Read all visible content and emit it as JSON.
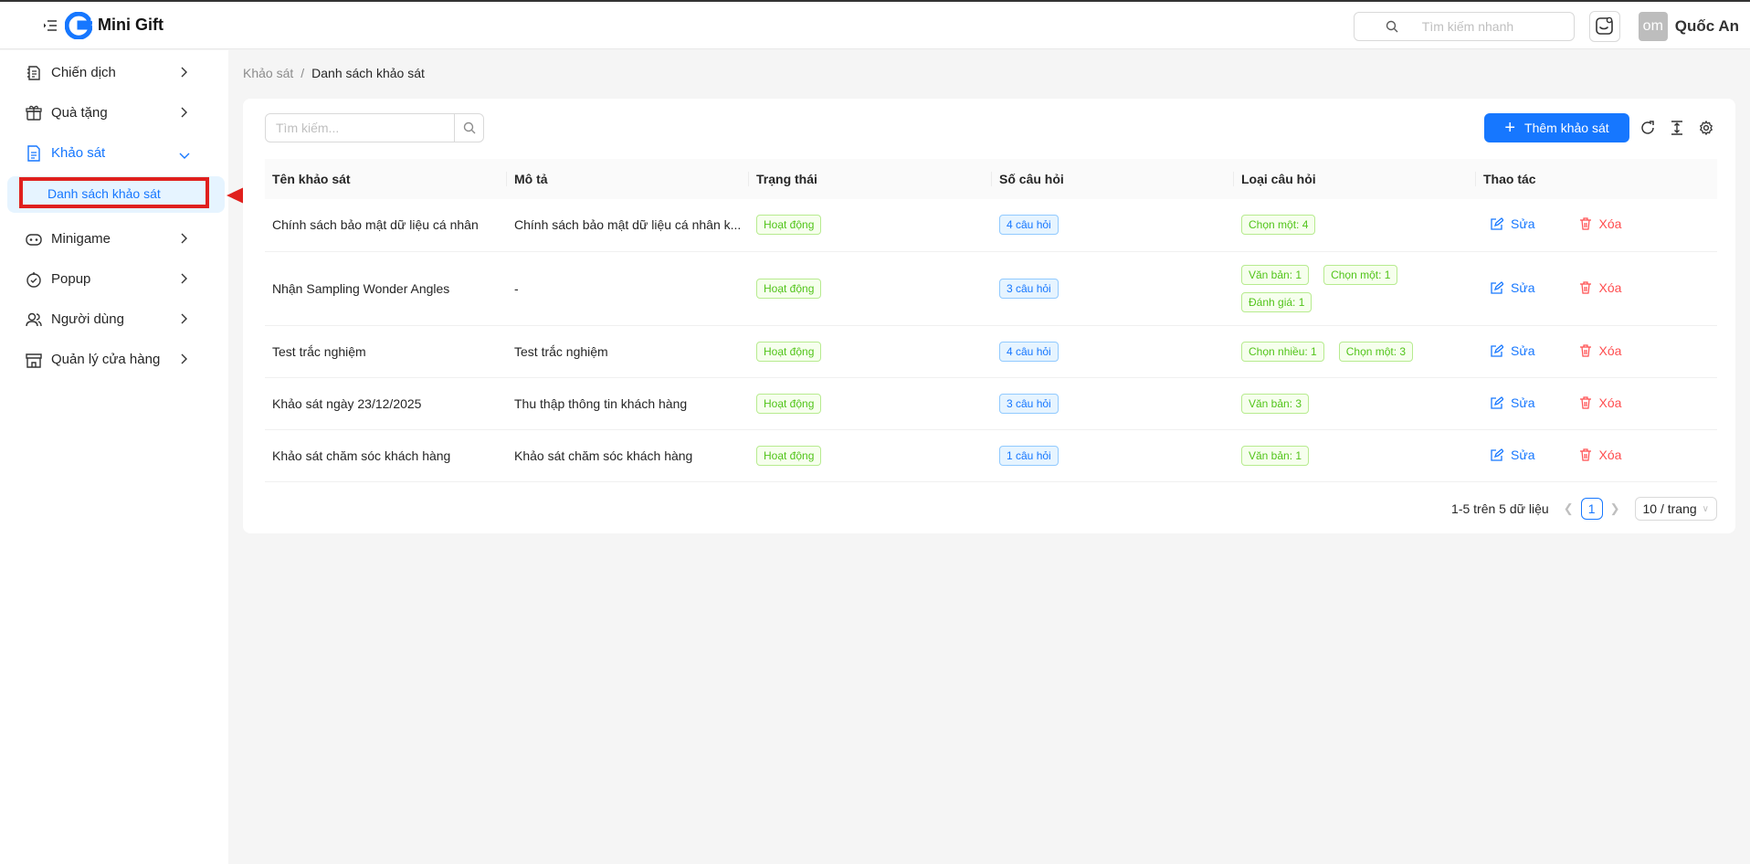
{
  "header": {
    "brand": "Mini Gift",
    "search_placeholder": "Tìm kiếm nhanh",
    "avatar_initials": "om",
    "username": "Quốc An"
  },
  "sidebar": {
    "items": [
      {
        "label": "Chiến dịch",
        "icon": "campaign-icon"
      },
      {
        "label": "Quà tặng",
        "icon": "gift-icon"
      },
      {
        "label": "Khảo sát",
        "icon": "survey-icon",
        "expanded": true
      },
      {
        "label": "Minigame",
        "icon": "gamepad-icon"
      },
      {
        "label": "Popup",
        "icon": "popup-icon"
      },
      {
        "label": "Người dùng",
        "icon": "users-icon"
      },
      {
        "label": "Quản lý cửa hàng",
        "icon": "store-icon"
      }
    ],
    "active_sub": "Danh sách khảo sát"
  },
  "breadcrumb": {
    "parent": "Khảo sát",
    "separator": "/",
    "current": "Danh sách khảo sát"
  },
  "toolbar": {
    "search_placeholder": "Tìm kiếm...",
    "add_label": "Thêm khảo sát"
  },
  "table": {
    "columns": [
      "Tên khảo sát",
      "Mô tả",
      "Trạng thái",
      "Số câu hỏi",
      "Loại câu hỏi",
      "Thao tác"
    ],
    "edit_label": "Sửa",
    "delete_label": "Xóa",
    "rows": [
      {
        "name": "Chính sách bảo mật dữ liệu cá nhân",
        "desc": "Chính sách bảo mật dữ liệu cá nhân k...",
        "status": "Hoạt động",
        "count": "4 câu hỏi",
        "types": [
          "Chọn một: 4"
        ]
      },
      {
        "name": "Nhận Sampling Wonder Angles",
        "desc": "-",
        "status": "Hoạt động",
        "count": "3 câu hỏi",
        "types": [
          "Văn bản: 1",
          "Chọn một: 1",
          "Đánh giá: 1"
        ]
      },
      {
        "name": "Test trắc nghiệm",
        "desc": "Test trắc nghiệm",
        "status": "Hoạt động",
        "count": "4 câu hỏi",
        "types": [
          "Chọn nhiều: 1",
          "Chọn một: 3"
        ]
      },
      {
        "name": "Khảo sát ngày 23/12/2025",
        "desc": "Thu thập thông tin khách hàng",
        "status": "Hoạt động",
        "count": "3 câu hỏi",
        "types": [
          "Văn bản: 3"
        ]
      },
      {
        "name": "Khảo sát chăm sóc khách hàng",
        "desc": "Khảo sát chăm sóc khách hàng",
        "status": "Hoạt động",
        "count": "1 câu hỏi",
        "types": [
          "Văn bản: 1"
        ]
      }
    ]
  },
  "pagination": {
    "summary": "1-5 trên 5 dữ liệu",
    "current_page": "1",
    "page_size": "10 / trang"
  },
  "colors": {
    "primary": "#1677ff",
    "success": "#52c41a",
    "danger": "#ff4d4f",
    "annotation": "#e0201d"
  }
}
